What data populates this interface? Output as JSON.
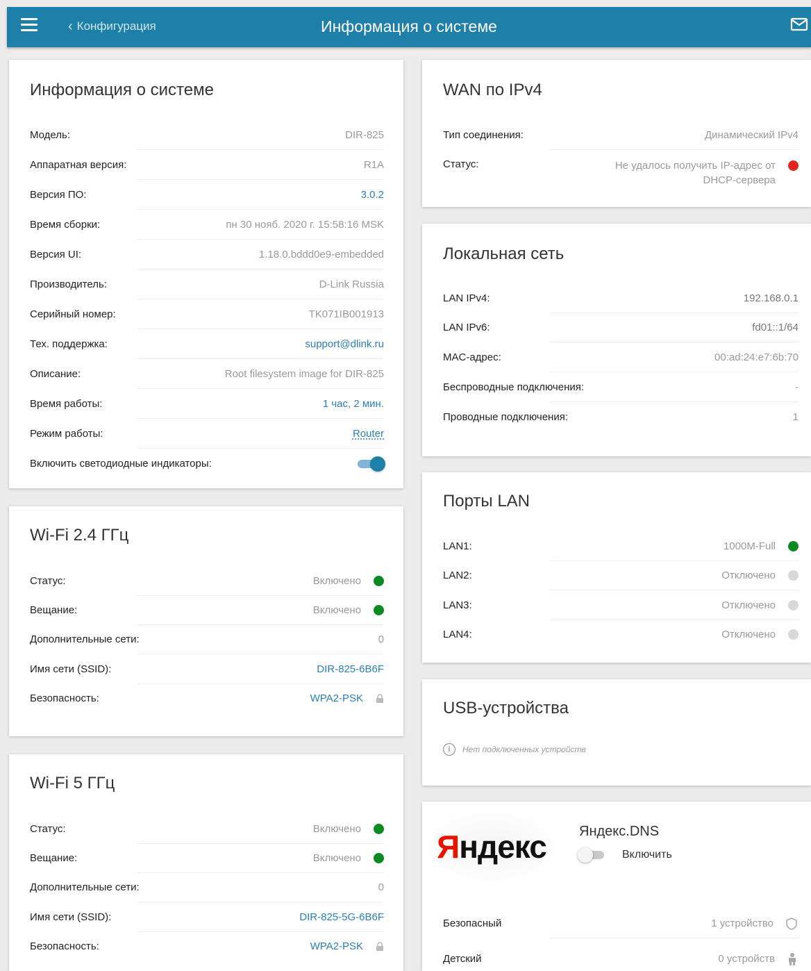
{
  "header": {
    "back_label": "Конфигурация",
    "title": "Информация о системе",
    "bg_color": "#1e7fa8"
  },
  "system": {
    "title": "Информация о системе",
    "rows": [
      {
        "label": "Модель:",
        "value": "DIR-825"
      },
      {
        "label": "Аппаратная версия:",
        "value": "R1A"
      },
      {
        "label": "Версия ПО:",
        "value": "3.0.2"
      },
      {
        "label": "Время сборки:",
        "value": "пн 30 нояб. 2020 г. 15:58:16 MSK"
      },
      {
        "label": "Версия UI:",
        "value": "1.18.0.bddd0e9-embedded"
      },
      {
        "label": "Производитель:",
        "value": "D-Link Russia"
      },
      {
        "label": "Серийный номер:",
        "value": "TK071IB001913"
      },
      {
        "label": "Тех. поддержка:",
        "value": "support@dlink.ru"
      },
      {
        "label": "Описание:",
        "value": "Root filesystem image for DIR-825"
      },
      {
        "label": "Время работы:",
        "value": "1 час, 2 мин."
      },
      {
        "label": "Режим работы:",
        "value": "Router"
      },
      {
        "label": "Включить светодиодные индикаторы:",
        "value": ""
      }
    ],
    "led_enabled": true
  },
  "wifi24": {
    "title": "Wi-Fi 2.4 ГГц",
    "rows": [
      {
        "label": "Статус:",
        "value": "Включено"
      },
      {
        "label": "Вещание:",
        "value": "Включено"
      },
      {
        "label": "Дополнительные сети:",
        "value": "0"
      },
      {
        "label": "Имя сети (SSID):",
        "value": "DIR-825-6B6F"
      },
      {
        "label": "Безопасность:",
        "value": "WPA2-PSK"
      }
    ]
  },
  "wifi5": {
    "title": "Wi-Fi 5 ГГц",
    "rows": [
      {
        "label": "Статус:",
        "value": "Включено"
      },
      {
        "label": "Вещание:",
        "value": "Включено"
      },
      {
        "label": "Дополнительные сети:",
        "value": "0"
      },
      {
        "label": "Имя сети (SSID):",
        "value": "DIR-825-5G-6B6F"
      },
      {
        "label": "Безопасность:",
        "value": "WPA2-PSK"
      }
    ]
  },
  "wan": {
    "title": "WAN по IPv4",
    "rows": [
      {
        "label": "Тип соединения:",
        "value": "Динамический IPv4"
      },
      {
        "label": "Статус:",
        "value_line1": "Не удалось получить IP-адрес от",
        "value_line2": "DHCP-сервера"
      }
    ]
  },
  "lan": {
    "title": "Локальная сеть",
    "rows": [
      {
        "label": "LAN IPv4:",
        "value": "192.168.0.1"
      },
      {
        "label": "LAN IPv6:",
        "value": "fd01::1/64"
      },
      {
        "label": "MAC-адрес:",
        "value": "00:ad:24:e7:6b:70"
      },
      {
        "label": "Беспроводные подключения:",
        "value": "-"
      },
      {
        "label": "Проводные подключения:",
        "value": "1"
      }
    ]
  },
  "ports": {
    "title": "Порты LAN",
    "rows": [
      {
        "label": "LAN1:",
        "value": "1000M-Full"
      },
      {
        "label": "LAN2:",
        "value": "Отключено"
      },
      {
        "label": "LAN3:",
        "value": "Отключено"
      },
      {
        "label": "LAN4:",
        "value": "Отключено"
      }
    ]
  },
  "usb": {
    "title": "USB-устройства",
    "note": "Нет подключенных устройств"
  },
  "yandex": {
    "logo_first": "Я",
    "logo_rest": "ндекс",
    "service_title": "Яндекс.DNS",
    "enable_label": "Включить",
    "enabled": false,
    "rows": [
      {
        "label": "Безопасный",
        "value": "1 устройство"
      },
      {
        "label": "Детский",
        "value": "0 устройств"
      }
    ]
  },
  "colors": {
    "link": "#2a7fb5",
    "status_green": "#0b8a22",
    "status_red": "#e0261f"
  }
}
